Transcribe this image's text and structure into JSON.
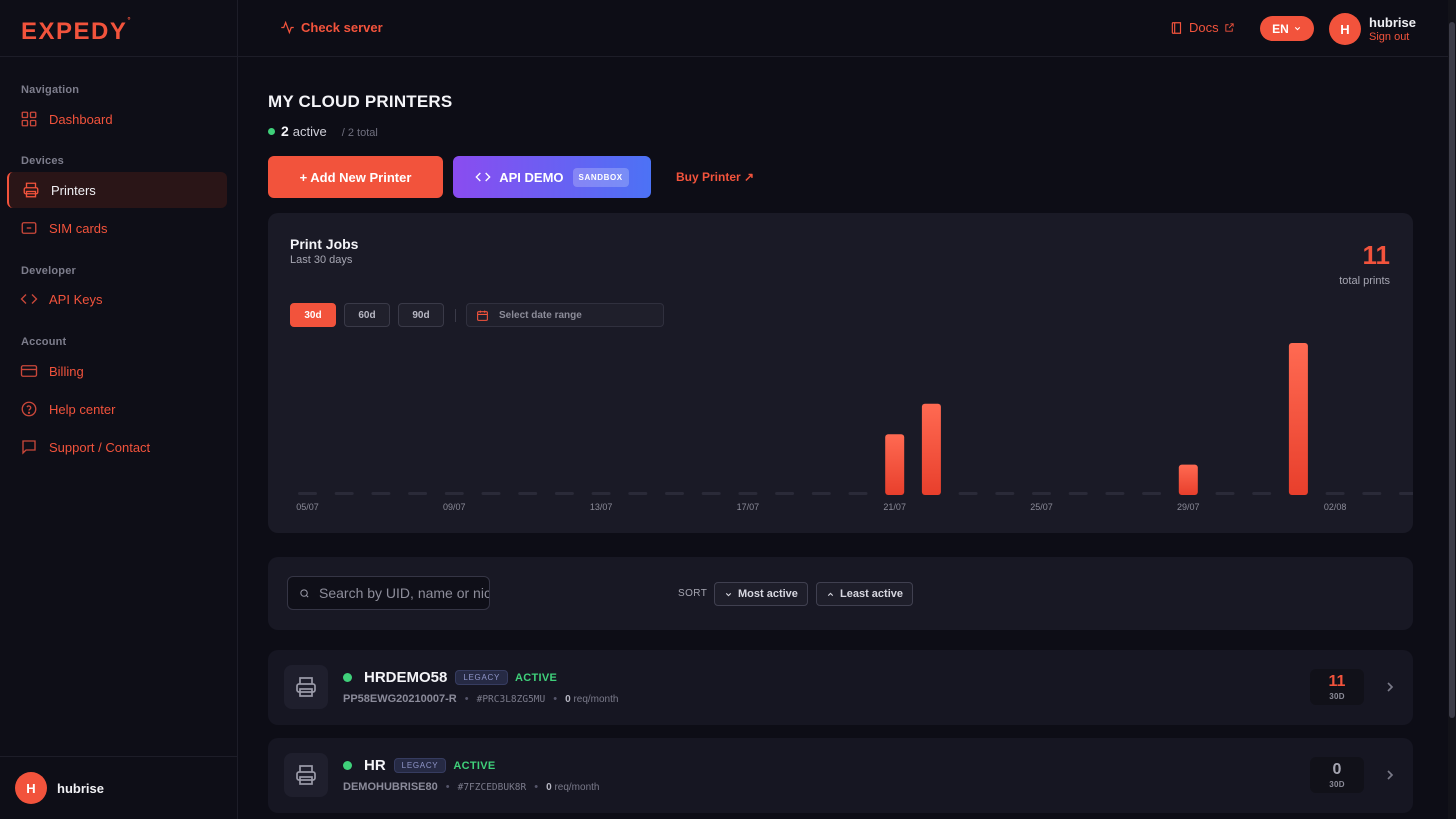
{
  "brand": {
    "logo": "EXPEDY",
    "logo_mark": "°"
  },
  "header": {
    "check_server": "Check server",
    "docs": "Docs",
    "lang": "EN",
    "user": {
      "initial": "H",
      "name": "hubrise",
      "sign_out": "Sign out"
    }
  },
  "sidebar": {
    "sections": [
      {
        "title": "Navigation",
        "items": [
          {
            "label": "Dashboard",
            "icon": "dashboard-grid-icon"
          }
        ]
      },
      {
        "title": "Devices",
        "items": [
          {
            "label": "Printers",
            "icon": "printer-icon",
            "active": true
          },
          {
            "label": "SIM cards",
            "icon": "sim-card-icon"
          }
        ]
      },
      {
        "title": "Developer",
        "items": [
          {
            "label": "API Keys",
            "icon": "code-icon"
          }
        ]
      },
      {
        "title": "Account",
        "items": [
          {
            "label": "Billing",
            "icon": "credit-card-icon"
          },
          {
            "label": "Help center",
            "icon": "help-circle-icon"
          },
          {
            "label": "Support / Contact",
            "icon": "message-icon"
          }
        ]
      }
    ],
    "footer": {
      "initial": "H",
      "name": "hubrise"
    }
  },
  "main": {
    "title": "MY CLOUD PRINTERS",
    "active_count": "2",
    "active_label": "active",
    "total_label": "/ 2 total",
    "add_button": "+ Add New Printer",
    "api_button": "API DEMO",
    "api_badge": "SANDBOX",
    "buy_link": "Buy Printer ↗"
  },
  "chart": {
    "title": "Print Jobs",
    "subtitle": "Last 30 days",
    "total": "11",
    "total_label": "total prints",
    "ranges": [
      "30d",
      "60d",
      "90d"
    ],
    "selected_range": "30d",
    "date_placeholder": "Select date range",
    "accent": "#f2533c"
  },
  "chart_data": {
    "type": "bar",
    "categories": [
      "05/07",
      "06/07",
      "07/07",
      "08/07",
      "09/07",
      "10/07",
      "11/07",
      "12/07",
      "13/07",
      "14/07",
      "15/07",
      "16/07",
      "17/07",
      "18/07",
      "19/07",
      "20/07",
      "21/07",
      "22/07",
      "23/07",
      "24/07",
      "25/07",
      "26/07",
      "27/07",
      "28/07",
      "29/07",
      "30/07",
      "31/07",
      "01/08",
      "02/08",
      "03/08",
      "04/08"
    ],
    "values": [
      0,
      0,
      0,
      0,
      0,
      0,
      0,
      0,
      0,
      0,
      0,
      0,
      0,
      0,
      0,
      0,
      2,
      3,
      0,
      0,
      0,
      0,
      0,
      0,
      1,
      0,
      0,
      5,
      0,
      0,
      0
    ],
    "tick_labels": [
      "05/07",
      "09/07",
      "13/07",
      "17/07",
      "21/07",
      "25/07",
      "29/07",
      "02/08"
    ],
    "ylim": [
      0,
      5
    ]
  },
  "filters": {
    "search_placeholder": "Search by UID, name or nickname",
    "sort_label": "SORT",
    "sort_most": "Most active",
    "sort_least": "Least active"
  },
  "printers": [
    {
      "name": "HRDEMO58",
      "badge": "LEGACY",
      "status": "ACTIVE",
      "serial": "PP58EWG20210007-R",
      "uid": "#PRC3L8ZG5MU",
      "req_value": "0",
      "req_unit": "req/month",
      "count": "11",
      "count_unit": "30D",
      "count_color": "#f2533c"
    },
    {
      "name": "HR",
      "badge": "LEGACY",
      "status": "ACTIVE",
      "serial": "DEMOHUBRISE80",
      "uid": "#7FZCEDBUK8R",
      "req_value": "0",
      "req_unit": "req/month",
      "count": "0",
      "count_unit": "30D",
      "count_color": "#a6a6b2"
    }
  ]
}
